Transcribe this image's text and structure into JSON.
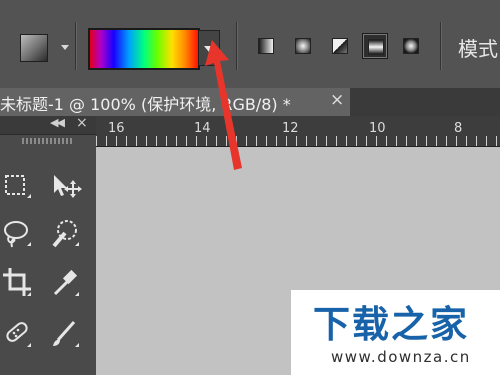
{
  "options_bar": {
    "tool_preset_icon": "gradient-tool-preset-icon",
    "gradient_picker_icon": "rainbow-gradient-swatch",
    "gradient_dropdown_icon": "chevron-down-icon",
    "gradient_types": [
      {
        "name": "linear-gradient-icon",
        "active": false
      },
      {
        "name": "radial-gradient-icon",
        "active": false
      },
      {
        "name": "angle-gradient-icon",
        "active": false
      },
      {
        "name": "reflected-gradient-icon",
        "active": true
      },
      {
        "name": "diamond-gradient-icon",
        "active": false
      }
    ],
    "mode_label": "模式"
  },
  "document_tab": {
    "title": "未标题-1 @ 100% (保护环境, RGB/8) *",
    "close_label": "×"
  },
  "tools_panel": {
    "collapse_label": "◀◀",
    "close_label": "×",
    "tools": [
      "rectangular-marquee-icon",
      "move-tool-icon",
      "lasso-icon",
      "quick-selection-icon",
      "crop-icon",
      "eyedropper-icon",
      "healing-brush-icon",
      "brush-icon"
    ]
  },
  "ruler": {
    "labels": [
      "16",
      "14",
      "12",
      "10",
      "8"
    ]
  },
  "annotation": {
    "arrow_color": "#e8352c"
  },
  "watermark": {
    "main_text": "下载之家",
    "url_text": "www.downza.cn",
    "color": "#1762a8"
  }
}
